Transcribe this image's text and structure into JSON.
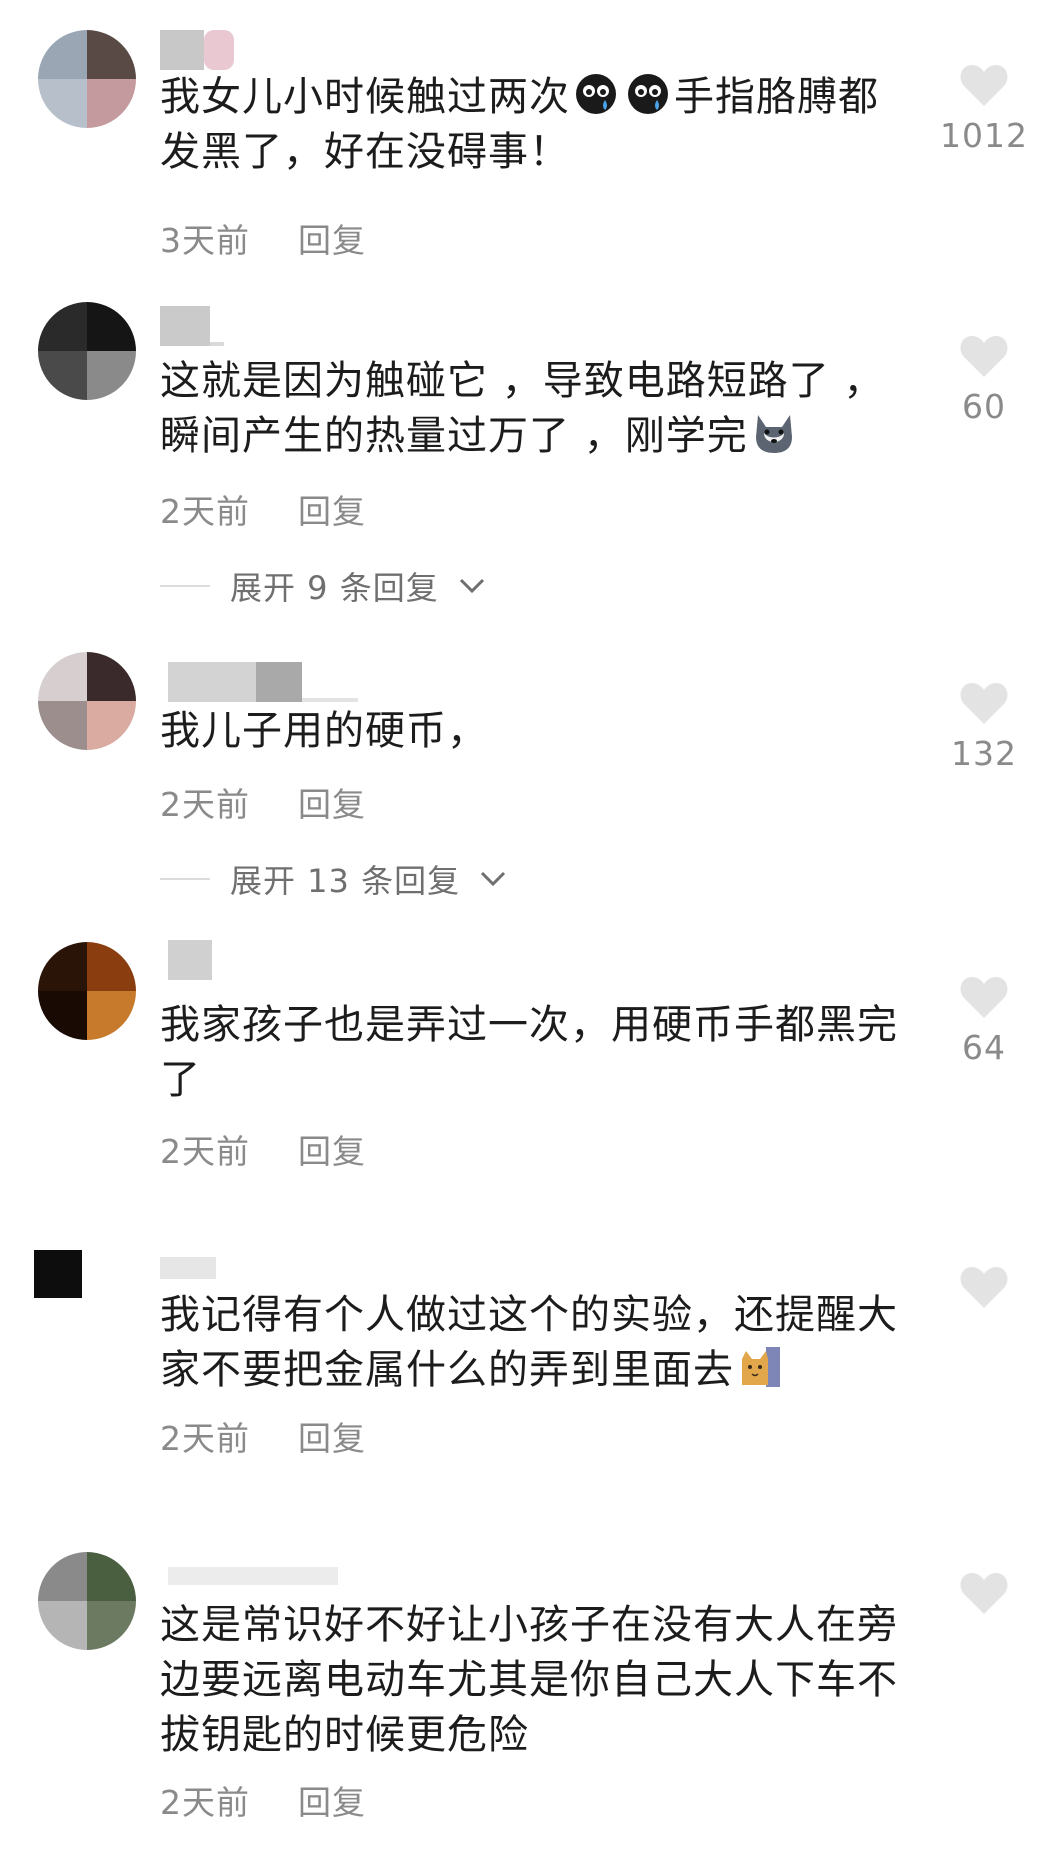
{
  "like_icon": "heart-icon",
  "colors": {
    "text": "#1c1c1c",
    "meta": "#8a8a8a",
    "heart": "#e3e3e3"
  },
  "comments": [
    {
      "text_before": "我女儿小时候触过两次",
      "emojis": [
        "crying-face-emoji",
        "crying-face-emoji"
      ],
      "text_after": "手指胳膊都发黑了，好在没碍事！",
      "time": "3天前",
      "reply_label": "回复",
      "likes": "1012"
    },
    {
      "text_before": "这就是因为触碰它 ，导致电路短路了 ，瞬间产生的热量过万了 ，刚学完",
      "emojis": [
        "husky-dog-emoji"
      ],
      "text_after": "",
      "time": "2天前",
      "reply_label": "回复",
      "likes": "60",
      "expand_label": "展开 9 条回复"
    },
    {
      "text_before": "我儿子用的硬币，",
      "emojis": [],
      "text_after": "",
      "time": "2天前",
      "reply_label": "回复",
      "likes": "132",
      "expand_label": "展开 13 条回复"
    },
    {
      "text_before": "我家孩子也是弄过一次，用硬币手都黑完了",
      "emojis": [],
      "text_after": "",
      "time": "2天前",
      "reply_label": "回复",
      "likes": "64"
    },
    {
      "text_before": "我记得有个人做过这个的实验，还提醒大家不要把金属什么的弄到里面去",
      "emojis": [
        "cat-peeking-emoji"
      ],
      "text_after": "",
      "time": "2天前",
      "reply_label": "回复",
      "likes": ""
    },
    {
      "text_before": "这是常识好不好让小孩子在没有大人在旁边要远离电动车尤其是你自己大人下车不拔钥匙的时候更危险",
      "emojis": [],
      "text_after": "",
      "time": "2天前",
      "reply_label": "回复",
      "likes": ""
    }
  ]
}
